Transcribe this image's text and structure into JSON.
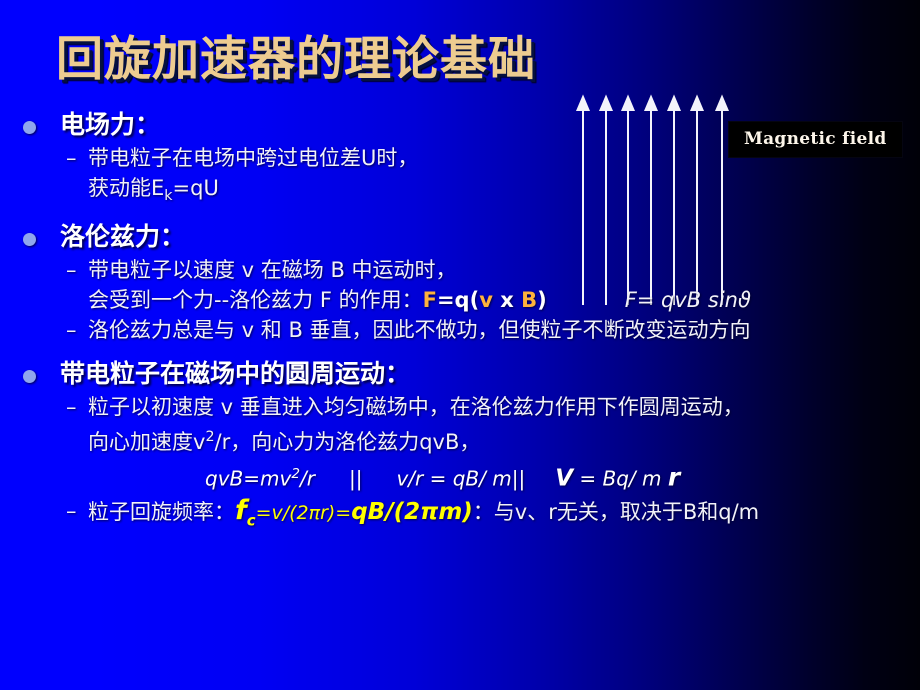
{
  "slide": {
    "title": "回旋加速器的理论基础",
    "background_left_color": "#0000FE",
    "background_right_color": "#000008",
    "title_color": "#EDCC90"
  },
  "graphic": {
    "label": "Magnetic field",
    "label_bg": "#000000",
    "arrow_count": 7,
    "arrow_color": "#FFFFFF",
    "arrow_direction": "up"
  },
  "sections": [
    {
      "heading": "电场力：",
      "lines": [
        "带电粒子在电场中跨过电位差U时，",
        "获动能E",
        "k",
        "=qU"
      ]
    },
    {
      "heading": "洛伦兹力：",
      "lines": [
        "带电粒子以速度 v 在磁场 B 中运动时，",
        "会受到一个力--洛伦兹力 F 的作用：",
        "洛伦兹力总是与 v 和 B 垂直，因此不做功，但使粒子不断改变运动方向"
      ]
    },
    {
      "heading": "带电粒子在磁场中的圆周运动：",
      "lines": [
        "粒子以初速度 v 垂直进入均匀磁场中，在洛伦兹力作用下作圆周运动，",
        "向心加速度v",
        "2",
        "/r，向心力为洛伦兹力qvB，",
        "粒子回旋频率：",
        "：与v、r无关，取决于B和q/m"
      ]
    }
  ],
  "formulas": {
    "lorentz_F": "F",
    "lorentz_eq_open": "=q(",
    "lorentz_v": "v",
    "lorentz_cross": "x",
    "lorentz_B": "B",
    "lorentz_eq_close": ")",
    "lorentz_scalar": "F=  qvB sinϑ",
    "circular_1": "qvB=mv",
    "circular_1_sup": "2",
    "circular_1_tail": "/r",
    "bars_1": "||",
    "circular_2": "v/r = qB/ m",
    "bars_2": "||",
    "circular_3_v": "V",
    "circular_3_mid": " = Bq/ m ",
    "circular_3_r": "r",
    "freq_fc": "f",
    "freq_fc_sub": "c",
    "freq_mid": "=v/(2πr)=",
    "freq_tail": "qB/(2πm)"
  },
  "colors": {
    "gold_accent": "#FFB23C",
    "yellow_accent": "#FFFF00",
    "bullet_dot": "#8FA6EE",
    "body_text": "#F2F2F8"
  }
}
